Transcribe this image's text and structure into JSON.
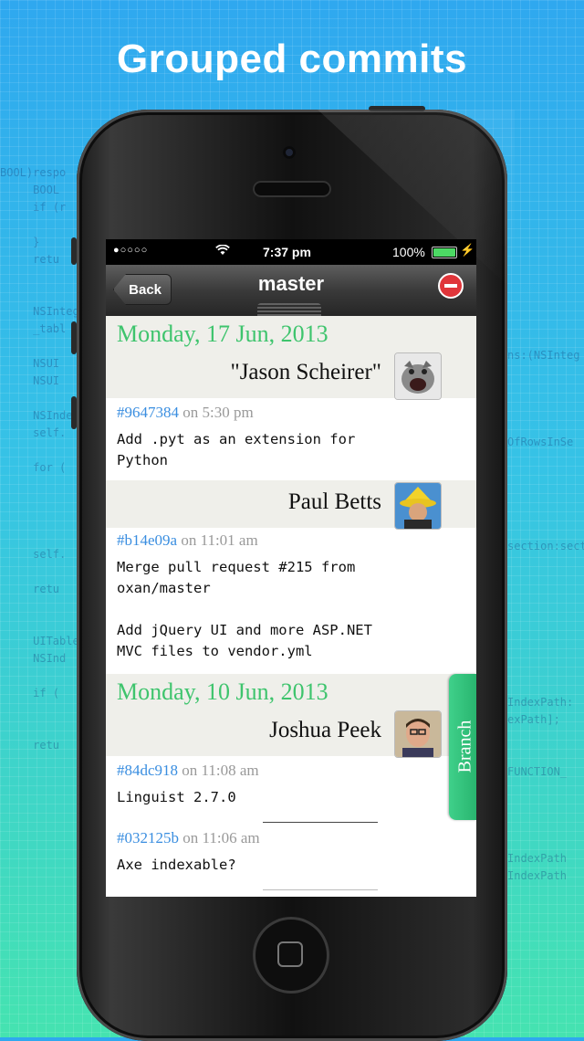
{
  "headline": "Grouped commits",
  "status_bar": {
    "signal": "●○○○○",
    "time": "7:37 pm",
    "battery": "100%"
  },
  "nav": {
    "back_label": "Back",
    "title": "master"
  },
  "branch_tab_label": "Branch",
  "groups": [
    {
      "date": "Monday, 17 Jun, 2013",
      "authors": [
        {
          "name": "\"Jason Scheirer\"",
          "commits": [
            {
              "sha": "#9647384",
              "time": "on 5:30 pm",
              "message": "Add .pyt as an extension for\nPython"
            }
          ]
        },
        {
          "name": "Paul Betts",
          "commits": [
            {
              "sha": "#b14e09a",
              "time": "on 11:01 am",
              "message": "Merge pull request #215 from\noxan/master\n\nAdd jQuery UI and more ASP.NET\nMVC files to vendor.yml"
            }
          ]
        }
      ]
    },
    {
      "date": "Monday, 10 Jun, 2013",
      "authors": [
        {
          "name": "Joshua Peek",
          "commits": [
            {
              "sha": "#84dc918",
              "time": "on 11:08 am",
              "message": "Linguist 2.7.0"
            },
            {
              "sha": "#032125b",
              "time": "on 11:06 am",
              "message": "Axe indexable?"
            }
          ]
        }
      ]
    }
  ],
  "bg_code": {
    "left": "BOOL)respo\n     BOOL\n     if (r\n\n     }\n     retu\n\n\n     NSInteger)\n     _tabl\n\n     NSUI\n     NSUI\n\n     NSIndex\n     self.\n\n     for (\n\n\n\n\n     self.\n\n     retu\n\n\n     UITableVie\n     NSInd\n\n     if (\n\n\n     retu",
    "right": "ns:(NSInteg\n\n\n\n\nOfRowsInSe\n\n\n\n\n\nsection:sect\n\n\n\n\n\n\n\n\nIndexPath:\nexPath];\n\n\nFUNCTION_\n\n\n\n\nIndexPath\nIndexPath"
  }
}
